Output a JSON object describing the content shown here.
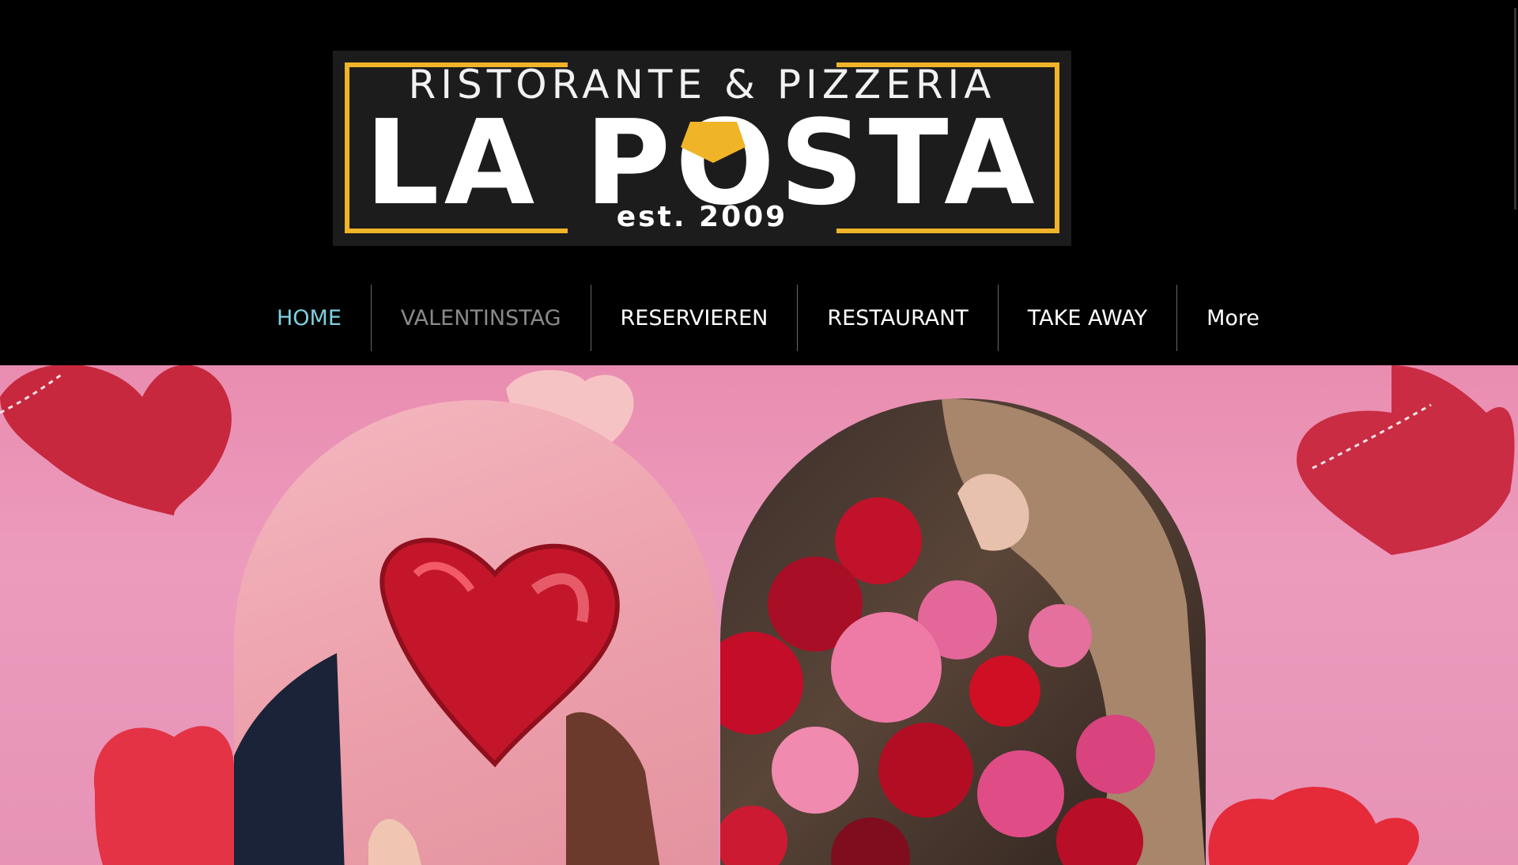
{
  "brand": {
    "line1": "RISTORANTE & PIZZERIA",
    "line2": "LA POSTA",
    "line3": "est. 2009",
    "accent": "#f0b429"
  },
  "nav": {
    "items": [
      {
        "label": "HOME",
        "state": "active"
      },
      {
        "label": "VALENTINSTAG",
        "state": "muted"
      },
      {
        "label": "RESERVIEREN",
        "state": "normal"
      },
      {
        "label": "RESTAURANT",
        "state": "normal"
      },
      {
        "label": "TAKE AWAY",
        "state": "normal"
      },
      {
        "label": "More",
        "state": "normal"
      }
    ],
    "active_color": "#7fd0e0"
  },
  "hero": {
    "background": "#e98db0",
    "images": [
      {
        "name": "couple-heart-balloon",
        "icon": "heart-balloon-icon"
      },
      {
        "name": "woman-with-roses",
        "icon": "roses-icon"
      }
    ]
  }
}
